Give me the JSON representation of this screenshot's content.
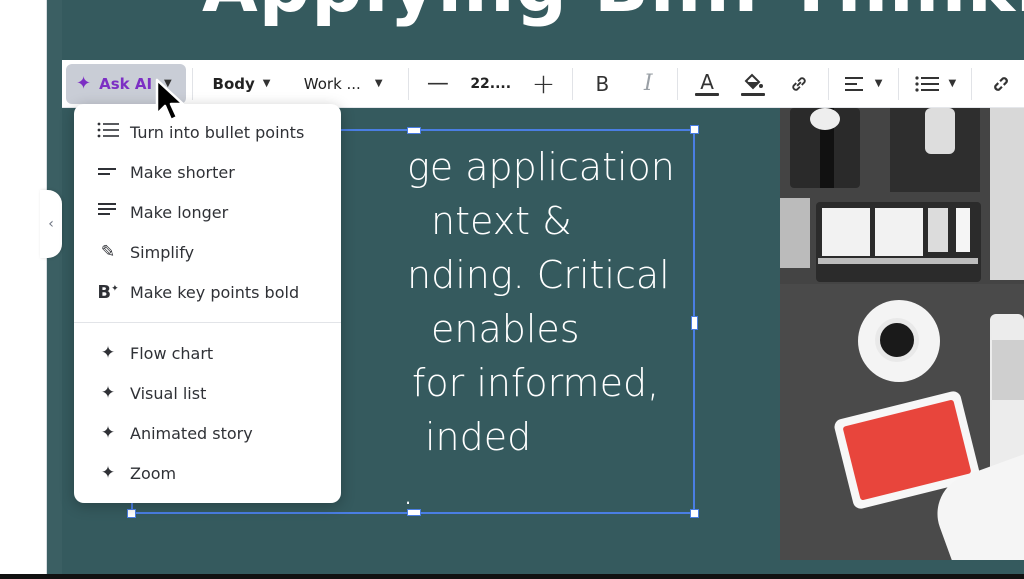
{
  "slide": {
    "title": "Applying Bi... Thinking",
    "body_lines": [
      "ge application",
      "ntext &",
      "nding. Critical",
      "enables",
      "for informed,",
      "inded",
      "."
    ]
  },
  "toolbar": {
    "ask_ai_label": "Ask AI",
    "text_style": "Body",
    "font_name": "Work ...",
    "font_size": "22....",
    "minus_icon": "minus-icon",
    "plus_icon": "plus-icon",
    "bold_glyph": "B",
    "italic_glyph": "I",
    "text_color_glyph": "A"
  },
  "menu": {
    "group1": [
      {
        "label": "Turn into bullet points",
        "icon": "bullet-list-icon"
      },
      {
        "label": "Make shorter",
        "icon": "short-lines-icon"
      },
      {
        "label": "Make longer",
        "icon": "long-lines-icon"
      },
      {
        "label": "Simplify",
        "icon": "pencil-icon"
      },
      {
        "label": "Make key points bold",
        "icon": "bold-sparkle-icon"
      }
    ],
    "group2": [
      {
        "label": "Flow chart",
        "icon": "sparkle-icon"
      },
      {
        "label": "Visual list",
        "icon": "sparkle-icon"
      },
      {
        "label": "Animated story",
        "icon": "sparkle-icon"
      },
      {
        "label": "Zoom",
        "icon": "sparkle-icon"
      }
    ]
  },
  "colors": {
    "slide_bg": "#355a5e",
    "accent_purple": "#7c2fc4",
    "selection_blue": "#4a7ee3",
    "tablet_red": "#e8453c"
  }
}
